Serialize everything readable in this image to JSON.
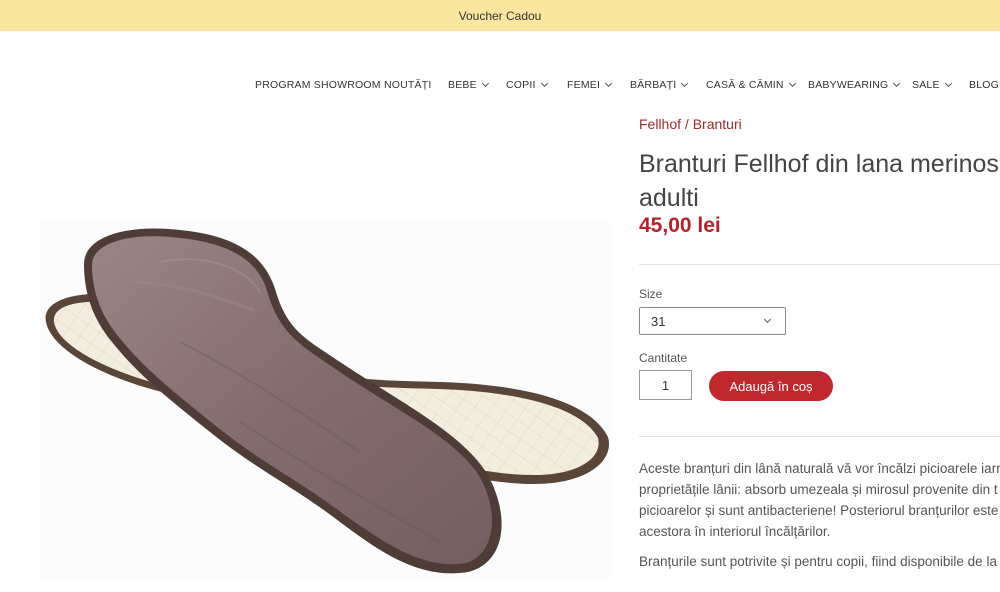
{
  "announcement": {
    "text": "Voucher Cadou"
  },
  "nav": {
    "items": [
      {
        "label": "PROGRAM SHOWROOM",
        "dropdown": false
      },
      {
        "label": "NOUTĂȚI",
        "dropdown": false
      },
      {
        "label": "BEBE",
        "dropdown": true
      },
      {
        "label": "COPII",
        "dropdown": true
      },
      {
        "label": "FEMEI",
        "dropdown": true
      },
      {
        "label": "BĂRBAȚI",
        "dropdown": true
      },
      {
        "label": "CASĂ & CĂMIN",
        "dropdown": true
      },
      {
        "label": "BABYWEARING",
        "dropdown": true
      },
      {
        "label": "SALE",
        "dropdown": true
      },
      {
        "label": "BLOG",
        "dropdown": false
      }
    ]
  },
  "product": {
    "breadcrumb": {
      "brand": "Fellhof",
      "separator": " / ",
      "category": "Branturi"
    },
    "title_line1": "Branturi Fellhof din lana merinos",
    "title_line2": "adulti",
    "price": "45,00 lei",
    "size_label": "Size",
    "size_value": "31",
    "quantity_label": "Cantitate",
    "quantity_value": "1",
    "add_to_cart": "Adaugă în coș",
    "description": [
      "Aceste branțuri din lână naturală vă vor încălzi picioarele iarn",
      "proprietățile lânii: absorb umezeala și mirosul provenite din t",
      "picioarelor și sunt antibacteriene! Posteriorul branțurilor este",
      "acestora în interiorul încălțărilor."
    ],
    "description2": "Branțurile sunt potrivite și pentru copii, fiind disponibile de la"
  },
  "colors": {
    "announcement_bg": "#f9e79f",
    "accent_red": "#c0282d",
    "price_red": "#b4232b",
    "fur": "#8a7474",
    "fur_dark": "#6e5a5a",
    "insole_base": "#f3ede0",
    "insole_rim": "#5a4638"
  }
}
